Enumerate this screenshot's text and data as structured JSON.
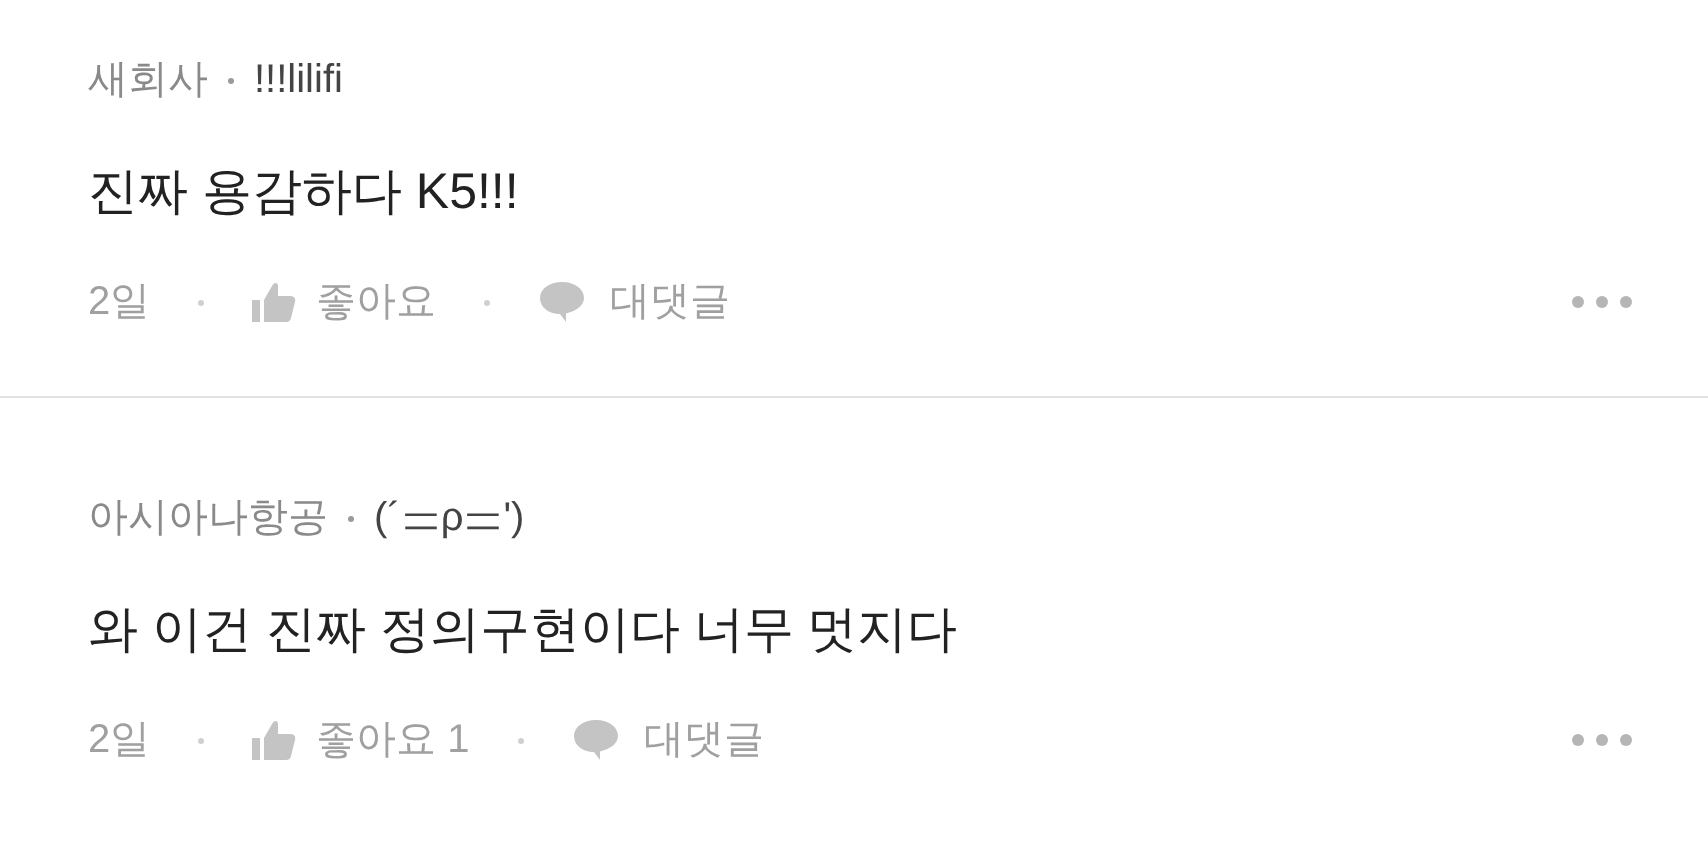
{
  "comments": [
    {
      "author": "새회사",
      "nickname": "!!!lilifi",
      "text": "진짜 용감하다 K5!!!",
      "time": "2일",
      "like_label": "좋아요",
      "reply_label": "대댓글"
    },
    {
      "author": "아시아나항공",
      "nickname": "(´ᆖρᆖ')",
      "text": "와 이건 진짜 정의구현이다 너무 멋지다",
      "time": "2일",
      "like_label": "좋아요 1",
      "reply_label": "대댓글"
    }
  ]
}
